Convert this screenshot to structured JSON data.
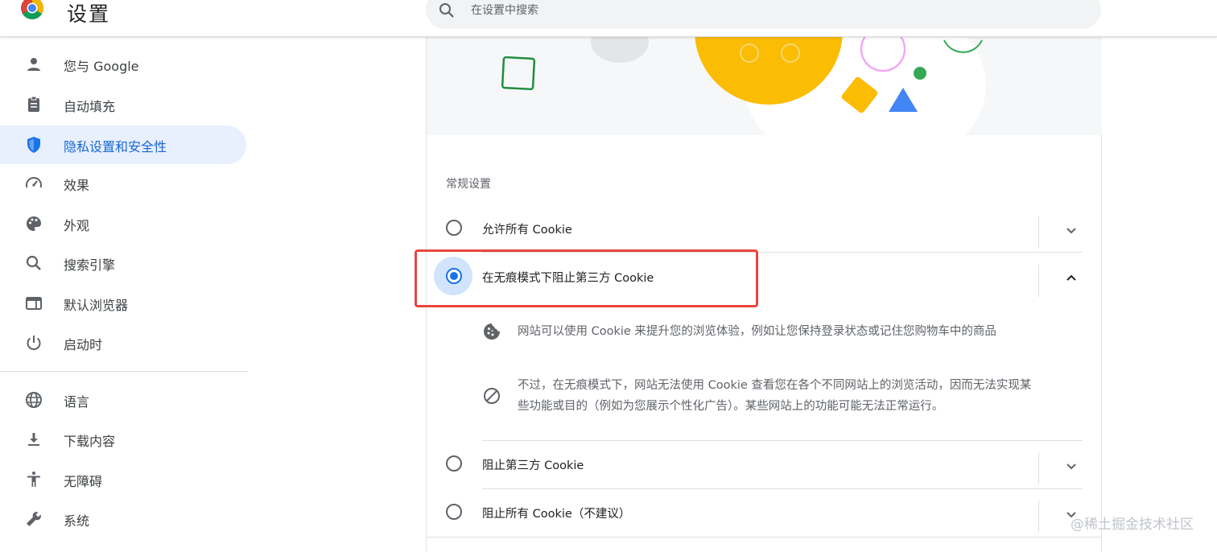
{
  "header": {
    "app_title": "设置",
    "search_placeholder": "在设置中搜索"
  },
  "sidebar": {
    "items": [
      {
        "label": "您与 Google",
        "icon": "person-icon"
      },
      {
        "label": "自动填充",
        "icon": "clipboard-icon"
      },
      {
        "label": "隐私设置和安全性",
        "icon": "shield-icon",
        "active": true
      },
      {
        "label": "效果",
        "icon": "speedometer-icon"
      },
      {
        "label": "外观",
        "icon": "palette-icon"
      },
      {
        "label": "搜索引擎",
        "icon": "search-icon"
      },
      {
        "label": "默认浏览器",
        "icon": "browser-window-icon"
      },
      {
        "label": "启动时",
        "icon": "power-icon"
      },
      {
        "label": "语言",
        "icon": "globe-icon"
      },
      {
        "label": "下载内容",
        "icon": "download-icon"
      },
      {
        "label": "无障碍",
        "icon": "accessibility-icon"
      },
      {
        "label": "系统",
        "icon": "wrench-icon"
      }
    ]
  },
  "main": {
    "section_title": "常规设置",
    "options": [
      {
        "label": "允许所有 Cookie",
        "selected": false,
        "expanded": false
      },
      {
        "label": "在无痕模式下阻止第三方 Cookie",
        "selected": true,
        "expanded": true
      },
      {
        "label": "阻止第三方 Cookie",
        "selected": false,
        "expanded": false
      },
      {
        "label": "阻止所有 Cookie（不建议）",
        "selected": false,
        "expanded": false
      }
    ],
    "details": [
      {
        "icon": "cookie-icon",
        "text": "网站可以使用 Cookie 来提升您的浏览体验，例如让您保持登录状态或记住您购物车中的商品"
      },
      {
        "icon": "block-icon",
        "line1": "不过，在无痕模式下，网站无法使用 Cookie 查看您在各个不同网站上的浏览活动，因而无法实现某",
        "line2": "些功能或目的（例如为您展示个性化广告）。某些网站上的功能可能无法正常运行。"
      }
    ]
  },
  "watermark": "@稀土掘金技术社区",
  "colors": {
    "accent": "#1a73e8",
    "active_nav_bg": "#e8f0fe",
    "highlight": "#e8463d"
  }
}
